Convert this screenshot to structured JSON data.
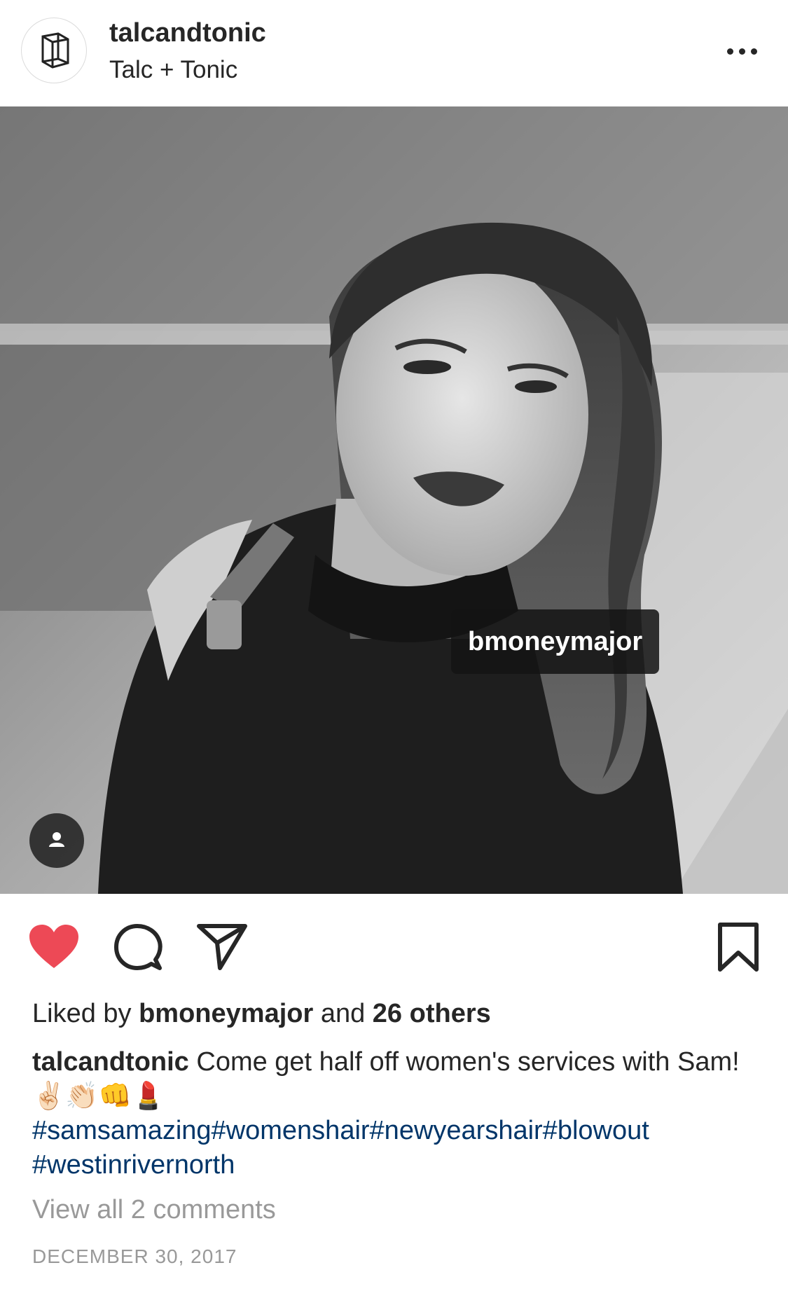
{
  "post_header": {
    "username": "talcandtonic",
    "display_name": "Talc + Tonic",
    "avatar_icon": "cube-logo-icon",
    "more_icon": "more-options-icon"
  },
  "photo": {
    "description_icon": "portrait-photo",
    "tag_username": "bmoneymajor",
    "user_tag_icon": "person-icon"
  },
  "actions": {
    "like_icon": "heart-icon",
    "liked": true,
    "like_color": "#ed4956",
    "comment_icon": "comment-icon",
    "share_icon": "send-icon",
    "save_icon": "bookmark-icon"
  },
  "likes": {
    "prefix": "Liked by ",
    "user": "bmoneymajor",
    "middle": " and ",
    "others": "26 others"
  },
  "caption": {
    "username": "talcandtonic",
    "text": " Come get half off women's services with Sam! ✌🏻👏🏻👊💄",
    "hashtags": "#samsamazing#womenshair#newyearshair#blowout #westinrivernorth",
    "hashtag_color": "#003569"
  },
  "comments": {
    "view_all": "View all 2 comments"
  },
  "date": "DECEMBER 30, 2017"
}
